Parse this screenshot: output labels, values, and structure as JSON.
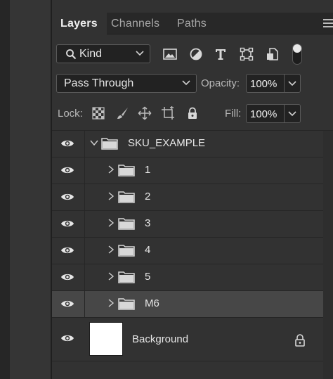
{
  "tabs": [
    {
      "label": "Layers",
      "active": true
    },
    {
      "label": "Channels",
      "active": false
    },
    {
      "label": "Paths",
      "active": false
    }
  ],
  "filter": {
    "kind_label": "Kind",
    "icons": [
      "image-filter-icon",
      "adjustment-filter-icon",
      "type-filter-icon",
      "shape-filter-icon",
      "smart-object-filter-icon"
    ]
  },
  "blend": {
    "mode": "Pass Through",
    "opacity_label": "Opacity:",
    "opacity_value": "100%"
  },
  "lock": {
    "label": "Lock:",
    "icons": [
      "lock-transparent-pixels-icon",
      "lock-image-pixels-icon",
      "lock-position-icon",
      "lock-artboard-icon",
      "lock-all-icon"
    ],
    "fill_label": "Fill:",
    "fill_value": "100%"
  },
  "layers": [
    {
      "name": "SKU_EXAMPLE",
      "type": "group",
      "expanded": true,
      "indent": 0,
      "selected": false
    },
    {
      "name": "1",
      "type": "group",
      "expanded": false,
      "indent": 1,
      "selected": false
    },
    {
      "name": "2",
      "type": "group",
      "expanded": false,
      "indent": 1,
      "selected": false
    },
    {
      "name": "3",
      "type": "group",
      "expanded": false,
      "indent": 1,
      "selected": false
    },
    {
      "name": "4",
      "type": "group",
      "expanded": false,
      "indent": 1,
      "selected": false
    },
    {
      "name": "5",
      "type": "group",
      "expanded": false,
      "indent": 1,
      "selected": false
    },
    {
      "name": "M6",
      "type": "group",
      "expanded": false,
      "indent": 1,
      "selected": true
    }
  ],
  "background_layer": {
    "name": "Background",
    "locked": true
  },
  "colors": {
    "panel_bg": "#323232",
    "input_bg": "#222222",
    "selected_row": "#474747",
    "text": "#e6e6e6"
  }
}
